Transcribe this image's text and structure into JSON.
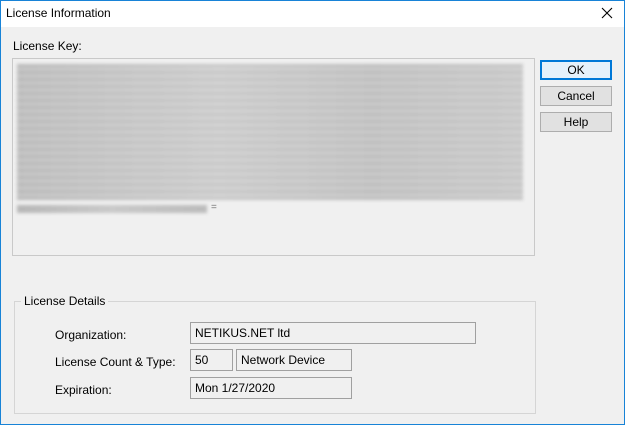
{
  "window": {
    "title": "License Information"
  },
  "license_key": {
    "label": "License Key:",
    "visible_tail": "="
  },
  "buttons": {
    "ok": "OK",
    "cancel": "Cancel",
    "help": "Help"
  },
  "details": {
    "group_title": "License Details",
    "organization": {
      "label": "Organization:",
      "value": "NETIKUS.NET ltd"
    },
    "count_type": {
      "label": "License Count & Type:",
      "count": "50",
      "type": "Network Device"
    },
    "expiration": {
      "label": "Expiration:",
      "value": "Mon 1/27/2020"
    }
  },
  "colors": {
    "window_border": "#1883d7",
    "default_button_border": "#0078d7",
    "dialog_bg": "#f0f0f0"
  },
  "icons": {
    "close": "close-icon"
  }
}
